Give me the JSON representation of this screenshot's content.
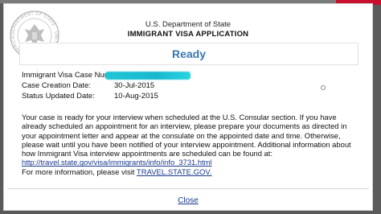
{
  "header": {
    "department": "U.S. Department of State",
    "title": "IMMIGRANT VISA APPLICATION",
    "seal_text": "DEPARTMENT OF STATE · UNITED STATES OF AMERICA"
  },
  "status": {
    "label": "Ready",
    "color": "#3a78b5"
  },
  "case": {
    "number_label": "Immigrant Visa Case Number:",
    "number_value": "",
    "creation_label": "Case Creation Date:",
    "creation_value": "30-Jul-2015",
    "updated_label": "Status Updated Date:",
    "updated_value": "10-Aug-2015"
  },
  "message": {
    "body": "Your case is ready for your interview when scheduled at the U.S. Consular section. If you have already scheduled an appointment for an interview, please prepare your documents as directed in your appointment letter and appear at the consulate on the appointed date and time. Otherwise, please wait until you have been notified of your interview appointment. Additional information about how Immigrant Visa interview appointments are scheduled can be found at: ",
    "link_text": "http://travel.state.gov/visa/immigrants/info/info_3731.html"
  },
  "footer": {
    "more_info": "For more information, please visit ",
    "more_info_link": "TRAVEL.STATE.GOV.",
    "close_label": "Close"
  }
}
